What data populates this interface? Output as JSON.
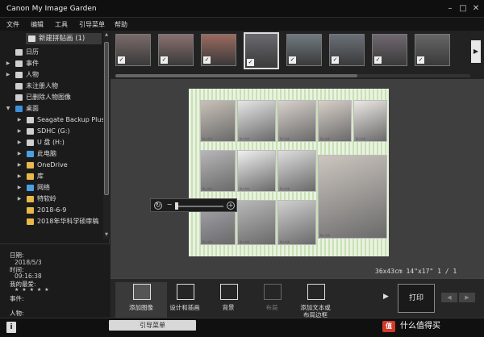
{
  "window": {
    "title": "Canon My Image Garden",
    "minimize": "–",
    "restore": "□",
    "close": "✕"
  },
  "menu": [
    "文件",
    "编辑",
    "工具",
    "引导菜单",
    "帮助"
  ],
  "sidebar": {
    "new_item": "新建拼贴画 (1)",
    "items": [
      {
        "label": "日历",
        "icon": "calendar-icon",
        "arrow": ""
      },
      {
        "label": "事件",
        "icon": "event-icon",
        "arrow": "▶"
      },
      {
        "label": "人物",
        "icon": "person-icon",
        "arrow": "▶"
      },
      {
        "label": "未注册人物",
        "icon": "unregistered-person-icon",
        "arrow": ""
      },
      {
        "label": "已删除人物图像",
        "icon": "deleted-person-icon",
        "arrow": ""
      },
      {
        "label": "桌面",
        "icon": "desktop-folder-icon",
        "arrow": "▼"
      },
      {
        "label": "Seagate Backup Plus",
        "icon": "drive-icon",
        "arrow": "▶"
      },
      {
        "label": "SDHC (G:)",
        "icon": "sd-card-icon",
        "arrow": "▶"
      },
      {
        "label": "U 盘 (H:)",
        "icon": "usb-drive-icon",
        "arrow": "▶"
      },
      {
        "label": "此电脑",
        "icon": "computer-icon",
        "arrow": "▶"
      },
      {
        "label": "OneDrive",
        "icon": "folder-icon",
        "arrow": "▶"
      },
      {
        "label": "库",
        "icon": "library-icon",
        "arrow": "▶"
      },
      {
        "label": "网络",
        "icon": "network-icon",
        "arrow": "▶"
      },
      {
        "label": "特软岭",
        "icon": "folder-icon",
        "arrow": "▶"
      },
      {
        "label": "2018-6-9",
        "icon": "folder-icon",
        "arrow": ""
      },
      {
        "label": "2018年华科学硕审稿",
        "icon": "folder-icon",
        "arrow": ""
      }
    ]
  },
  "info": {
    "date_label": "日期:",
    "date_value": "2018/5/3",
    "time_label": "时间:",
    "time_value": "09:16:38",
    "favorite_label": "我的最爱:",
    "favorite_value": "★ ★ ★ ★ ★",
    "event_label": "事件:",
    "person_label": "人物:"
  },
  "thumbnails": [
    {
      "checked": true,
      "selected": false
    },
    {
      "checked": true,
      "selected": false
    },
    {
      "checked": true,
      "selected": false
    },
    {
      "checked": true,
      "selected": true
    },
    {
      "checked": true,
      "selected": false
    },
    {
      "checked": true,
      "selected": false
    },
    {
      "checked": true,
      "selected": false
    },
    {
      "checked": true,
      "selected": false
    }
  ],
  "canvas": {
    "status": "36x43cm 14\"x17\"  1 / 1",
    "caption": "输入文本"
  },
  "tools": [
    {
      "label": "添加图像",
      "icon": "add-image-icon",
      "disabled": false,
      "active": true
    },
    {
      "label": "设计和插画",
      "icon": "design-icon",
      "disabled": false,
      "active": false
    },
    {
      "label": "背景",
      "icon": "background-icon",
      "disabled": false,
      "active": false
    },
    {
      "label": "布局",
      "icon": "layout-icon",
      "disabled": true,
      "active": false
    },
    {
      "label": "添加文本或\n布局边框",
      "icon": "add-text-icon",
      "disabled": false,
      "active": false
    }
  ],
  "print_label": "打印",
  "bottom": {
    "info_button": "i",
    "guide_tab": "引导菜单"
  },
  "watermark": {
    "badge": "值",
    "text": "什么值得买"
  },
  "colors": {
    "background": "#1e1e1e",
    "page": "#e9f3de",
    "accent": "#d43a2a"
  }
}
